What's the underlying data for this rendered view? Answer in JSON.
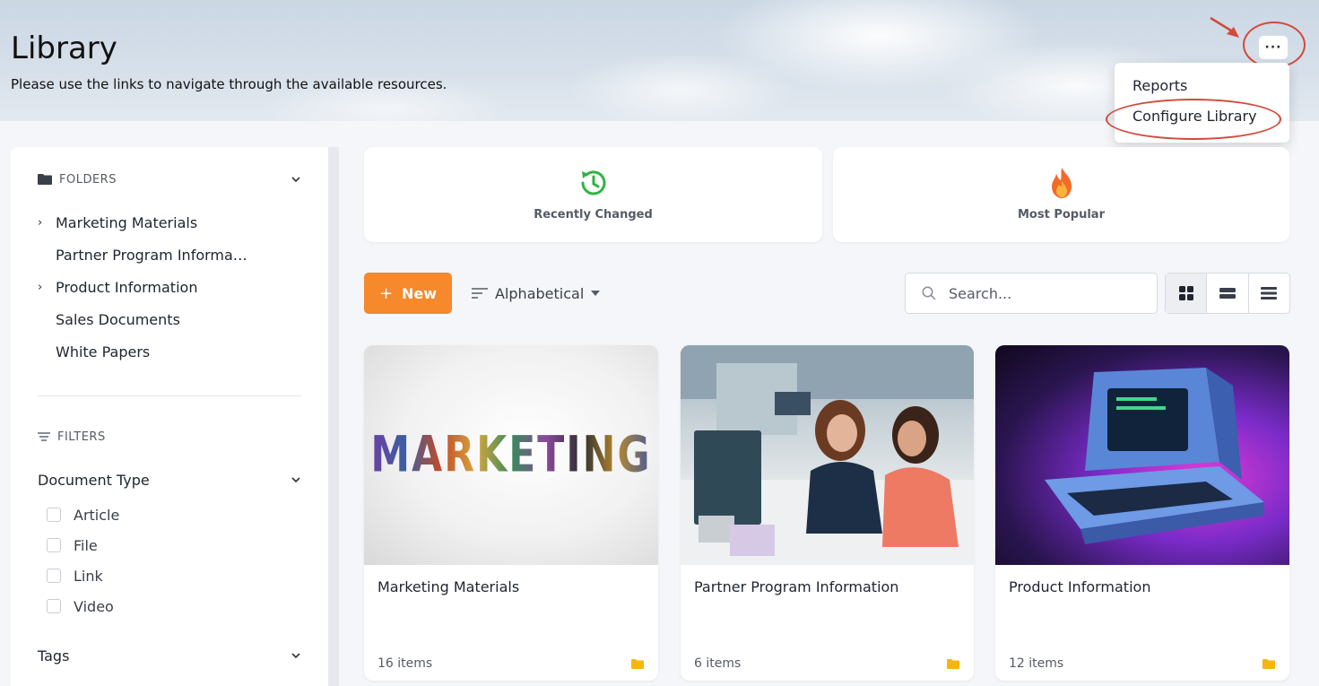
{
  "header": {
    "title": "Library",
    "subtitle": "Please use the links to navigate through the available resources.",
    "more_label": "···"
  },
  "menu": {
    "items": [
      {
        "label": "Reports"
      },
      {
        "label": "Configure Library"
      }
    ]
  },
  "sidebar": {
    "folders_label": "FOLDERS",
    "folders": [
      {
        "label": "Marketing Materials",
        "expandable": true
      },
      {
        "label": "Partner Program Informa…",
        "expandable": false
      },
      {
        "label": "Product Information",
        "expandable": true
      },
      {
        "label": "Sales Documents",
        "expandable": false
      },
      {
        "label": "White Papers",
        "expandable": false
      }
    ],
    "filters_label": "FILTERS",
    "document_type_label": "Document Type",
    "document_types": [
      {
        "label": "Article"
      },
      {
        "label": "File"
      },
      {
        "label": "Link"
      },
      {
        "label": "Video"
      }
    ],
    "tags_label": "Tags"
  },
  "stats": {
    "recently_changed": "Recently Changed",
    "most_popular": "Most Popular"
  },
  "toolbar": {
    "new_label": "New",
    "new_icon": "+",
    "sort_label": "Alphabetical",
    "search_placeholder": "Search..."
  },
  "cards": [
    {
      "name": "Marketing Materials",
      "count": "16 items",
      "thumb_text": "MARKETING"
    },
    {
      "name": "Partner Program Information",
      "count": "6 items"
    },
    {
      "name": "Product Information",
      "count": "12 items"
    }
  ],
  "colors": {
    "accent_orange": "#f5892b",
    "annotation_red": "#d24a3a",
    "clock_green": "#2fb344",
    "folder_yellow": "#f6b60e"
  }
}
